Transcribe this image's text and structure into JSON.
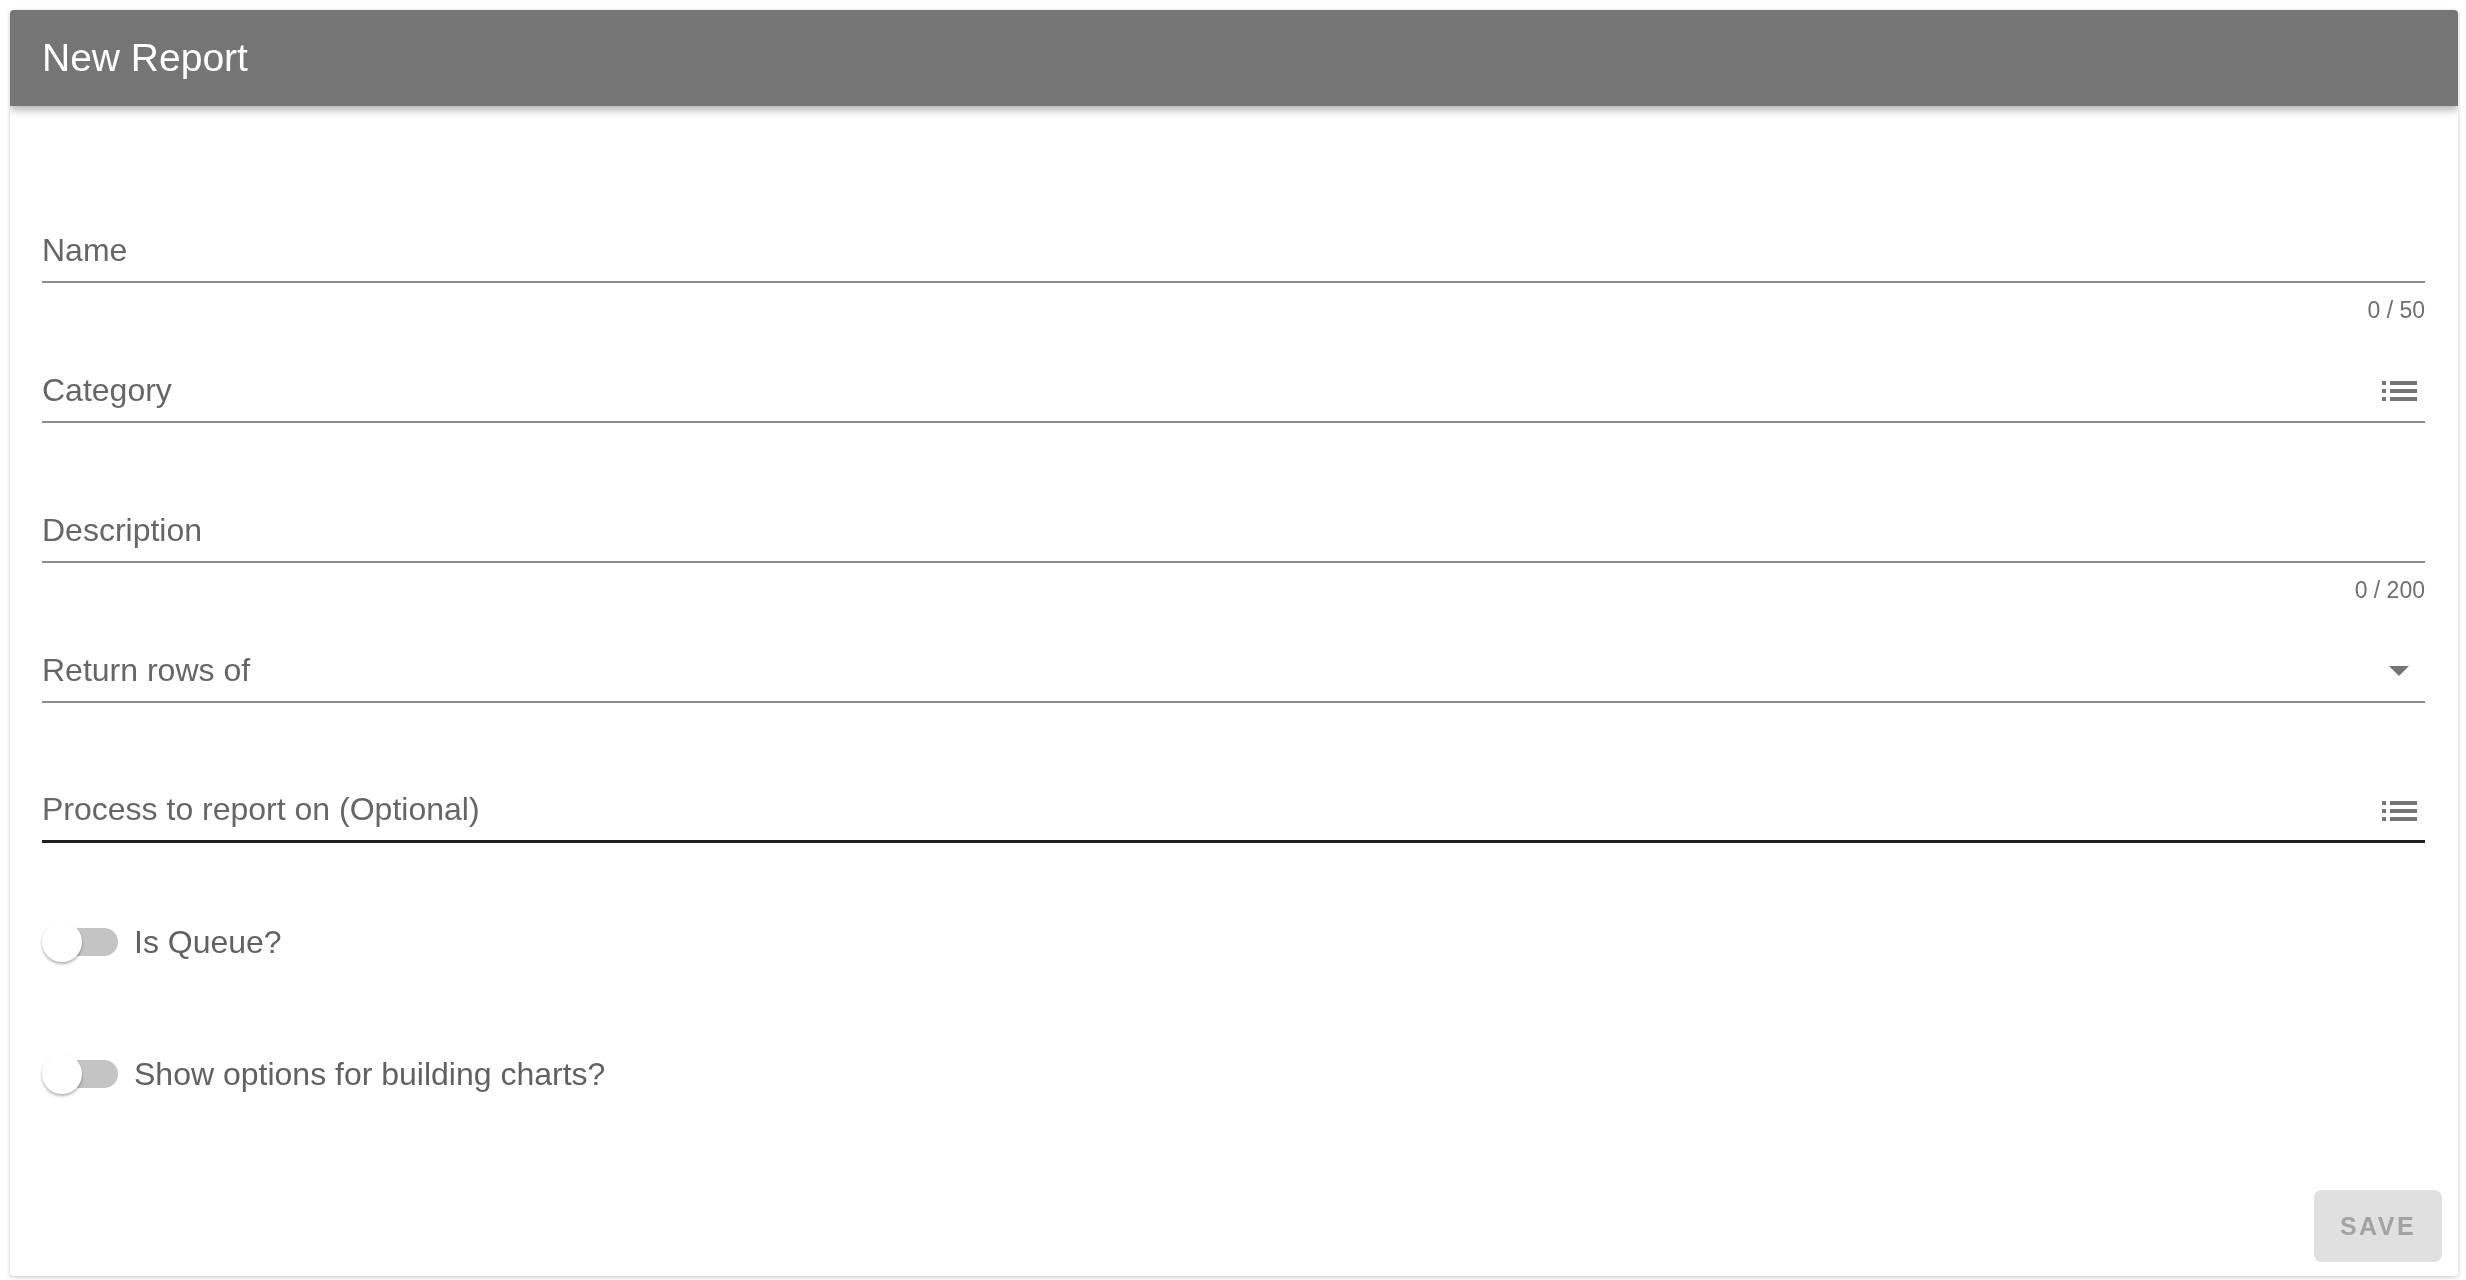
{
  "header": {
    "title": "New Report"
  },
  "fields": [
    {
      "kind": "text",
      "placeholder": "Name",
      "counter": "0 / 50",
      "hovered": false
    },
    {
      "kind": "lookup",
      "placeholder": "Category",
      "hovered": false
    },
    {
      "kind": "text",
      "placeholder": "Description",
      "counter": "0 / 200",
      "hovered": false
    },
    {
      "kind": "select",
      "placeholder": "Return rows of",
      "hovered": false
    },
    {
      "kind": "lookup",
      "placeholder": "Process to report on (Optional)",
      "hovered": true
    }
  ],
  "toggles": [
    {
      "label": "Is Queue?",
      "on": false
    },
    {
      "label": "Show options for building charts?",
      "on": false
    }
  ],
  "save_button": {
    "label": "SAVE",
    "disabled": true
  }
}
